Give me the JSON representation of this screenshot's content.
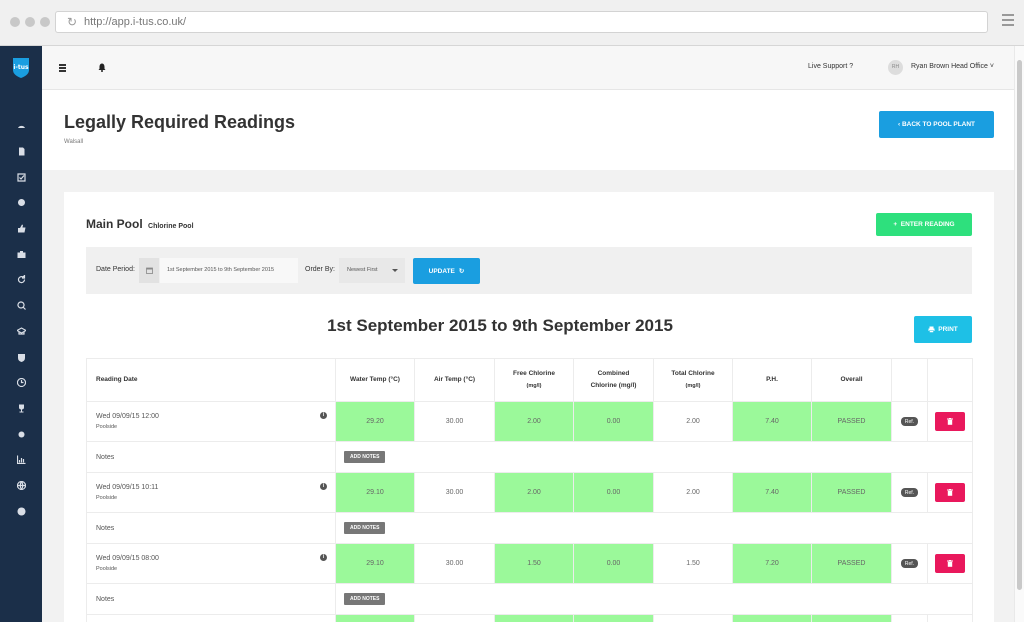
{
  "browser": {
    "url": "http://app.i-tus.co.uk/"
  },
  "sidebar": {
    "logo_text": "i-tus",
    "icons": [
      "dashboard-icon",
      "document-icon",
      "checkbox-icon",
      "settings-cog-icon",
      "thumbs-up-icon",
      "briefcase-icon",
      "refresh-icon",
      "search-icon",
      "graduation-cap-icon",
      "shield-icon",
      "clock-icon",
      "trophy-icon",
      "gear-icon",
      "bar-chart-icon",
      "globe-icon",
      "help-icon"
    ]
  },
  "topbar": {
    "live_support": "Live Support ?",
    "avatar_initials": "RH",
    "user_name": "Ryan Brown Head Office"
  },
  "header": {
    "title": "Legally Required Readings",
    "subtitle": "Walsall",
    "back_button": "BACK TO POOL PLANT"
  },
  "card": {
    "pool_name": "Main Pool",
    "pool_type": "Chlorine Pool",
    "enter_reading": "ENTER READING",
    "filter": {
      "date_label": "Date Period:",
      "date_value": "1st September 2015 to 9th September 2015",
      "order_label": "Order By:",
      "order_value": "Newest First",
      "update_button": "UPDATE"
    },
    "range_title": "1st September 2015 to 9th September 2015",
    "print_button": "PRINT"
  },
  "table": {
    "headers": {
      "reading_date": "Reading Date",
      "water_temp": "Water Temp (°C)",
      "air_temp": "Air Temp (°C)",
      "free_chlorine_1": "Free Chlorine",
      "free_chlorine_2": "(mg/l)",
      "combined_1": "Combined",
      "combined_2": "Chlorine (mg/l)",
      "total_1": "Total Chlorine",
      "total_2": "(mg/l)",
      "ph": "P.H.",
      "overall": "Overall"
    },
    "notes_label": "Notes",
    "add_notes": "ADD NOTES",
    "ref_label": "Ref.",
    "rows": [
      {
        "date": "Wed 09/09/15 12:00",
        "location": "Poolside",
        "water_temp": "29.20",
        "air_temp": "30.00",
        "free_chlorine": "2.00",
        "combined_chlorine": "0.00",
        "total_chlorine": "2.00",
        "ph": "7.40",
        "overall": "PASSED"
      },
      {
        "date": "Wed 09/09/15 10:11",
        "location": "Poolside",
        "water_temp": "29.10",
        "air_temp": "30.00",
        "free_chlorine": "2.00",
        "combined_chlorine": "0.00",
        "total_chlorine": "2.00",
        "ph": "7.40",
        "overall": "PASSED"
      },
      {
        "date": "Wed 09/09/15 08:00",
        "location": "Poolside",
        "water_temp": "29.10",
        "air_temp": "30.00",
        "free_chlorine": "1.50",
        "combined_chlorine": "0.00",
        "total_chlorine": "1.50",
        "ph": "7.20",
        "overall": "PASSED"
      }
    ]
  },
  "colors": {
    "sidebar": "#1b2f49",
    "primary": "#1a9ee0",
    "success": "#2ee07d",
    "passed_cell": "#9bf99a",
    "danger": "#e9185c",
    "print": "#1ec0e6"
  }
}
